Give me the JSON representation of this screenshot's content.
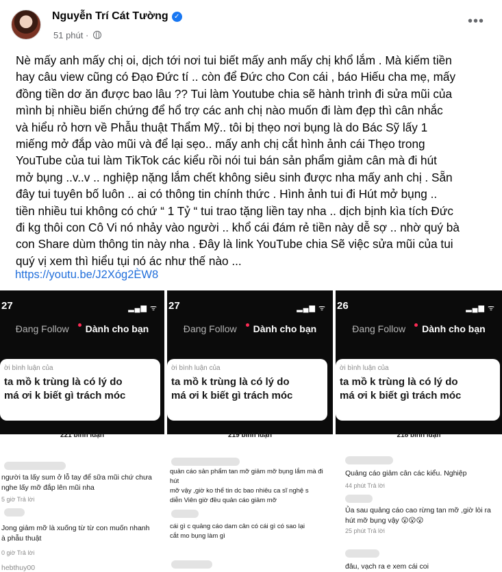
{
  "post": {
    "author": "Nguyễn Trí Cát Tường",
    "time": "51 phút ·",
    "verified_icon": "verified-badge-icon",
    "menu_icon": "more-options-icon",
    "body": "Nè mấy anh mấy chị oi, dịch tới nơi tui biết mấy anh mấy chị khổ lắm . Mà kiếm tiền\nhay câu view cũng có  Đạo Đức tí .. còn để Đức cho Con cái , báo Hiếu cha mẹ, mấy\nđồng tiền dơ ăn được bao lâu ?? Tui làm Youtube chia sẽ hành trình đi sửa  mũi của\nmình bị nhiều biến chứng để hổ trợ các anh chị nào muốn đi làm đẹp thì cân nhắc\nvà hiểu rỏ hơn về Phẫu thuật Thẩm Mỹ.. tôi bị thẹo  nơi bụng là do Bác Sỹ lấy 1\nmiếng mở đắp vào mũi và để lại sẹo.. mấy anh chị cắt  hình ảnh cái Thẹo trong\nYouTube của tui làm TikTok các kiểu rồi nói tui bán sản phẩm giảm cân mà đi hút\nmở bụng ..v..v .. nghiệp nặng lắm chết không siêu sinh được nha mấy anh chị . Sẵn\nđây tui tuyên bố luôn .. ai có thông tin chính thức . Hình ảnh tui đi Hút mở bụng ..\ntiền nhiều tui không có chứ “ 1 Tỷ “ tui trao tặng liền tay nha .. dịch bịnh kìa tích Đức\nđi kg thôi con Cô Vi nó nhảy vào người .. khổ cái đám rẻ tiền này dễ sợ .. nhờ quý bà\ncon Share dùm thông tin này nha . Đây là link YouTube chia Sẽ việc sửa mũi của tui\nquý vị xem thì hiểu tụi nó ác như thế nào ...",
    "link": "https://youtu.be/J2Xóg2ÈW8"
  },
  "screenshots": [
    {
      "time": "27",
      "tab_following": "Đang Follow",
      "tab_for_you": "Dành cho bạn",
      "card_from": "ời bình luận của",
      "card_text": "ta mồ k trùng là có lý do\nmá ơi k biết gì trách móc",
      "count": "221 bình luận",
      "comments": [
        {
          "text": "người ta lấy sum ở lỗ tay để sữa mũi chứ chưa\nnghe lấy mỡ đắp lên mũi nha",
          "meta": "5 giờ   Trả lời"
        },
        {
          "text": "Jong giảm mỡ là xuống từ từ con muốn nhanh\nà phẫu thuật",
          "meta": "0 giờ   Trả lời"
        },
        {
          "text": "hebthuy00",
          "meta": ""
        }
      ]
    },
    {
      "time": "27",
      "tab_following": "Đang Follow",
      "tab_for_you": "Dành cho bạn",
      "card_from": "ời bình luận của",
      "card_text": "ta mồ k trùng là có lý do\nmá ơi k biết gì trách móc",
      "count": "219 bình luận",
      "comments": [
        {
          "text": "quản cáo sản phẩm tan mỡ giảm mỡ bụng lắm mà đi hút\nmỡ vậy ,giờ ko thể tin dc bao nhiêu ca sĩ nghệ s\ndiễn Viên giờ đều quản cáo giảm mỡ",
          "meta": ""
        },
        {
          "text": "cái gì c quảng cáo dam cân có cái gì có sao lại\ncắt mo bụng làm gì",
          "meta": ""
        }
      ]
    },
    {
      "time": "26",
      "tab_following": "Đang Follow",
      "tab_for_you": "Dành cho bạn",
      "card_from": "ời bình luận của",
      "card_text": "ta mồ k trùng là có lý do\nmá ơi k biết gì trách móc",
      "count": "218 bình luận",
      "comments": [
        {
          "text": "Quảng cáo giảm cân các kiểu. Nghiệp",
          "meta": "44 phút   Trả lời"
        },
        {
          "text": "Ủa sau quảng cáo cao rừng tan mỡ ,giờ lòi ra\nhút mỡ bụng vậy 😮😮😮",
          "meta": "25 phút   Trả lời"
        },
        {
          "text": "đâu, vạch ra e xem cái coi",
          "meta": ""
        }
      ]
    }
  ]
}
